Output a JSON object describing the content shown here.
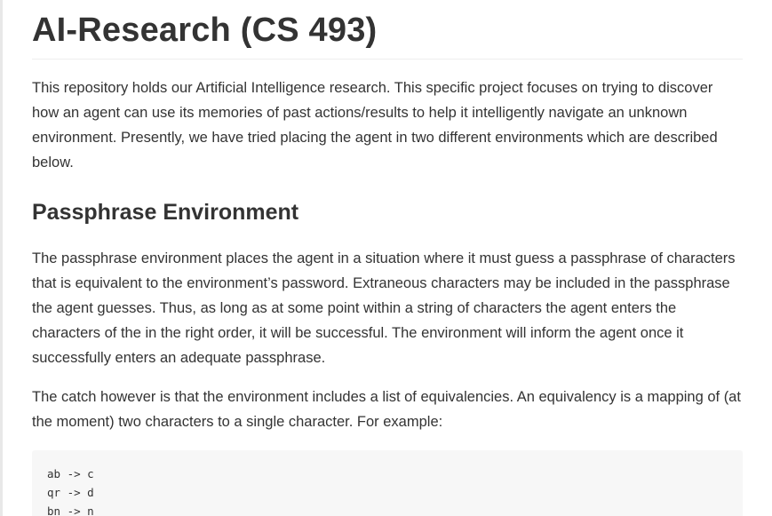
{
  "document": {
    "title": "AI-Research (CS 493)",
    "intro": "This repository holds our Artificial Intelligence research. This specific project focuses on trying to discover how an agent can use its memories of past actions/results to help it intelligently navigate an unknown environment. Presently, we have tried placing the agent in two different environments which are described below.",
    "sections": [
      {
        "heading": "Passphrase Environment",
        "paragraphs": [
          "The passphrase environment places the agent in a situation where it must guess a passphrase of characters that is equivalent to the environment’s password. Extraneous characters may be included in the passphrase the agent guesses. Thus, as long as at some point within a string of characters the agent enters the characters of the in the right order, it will be successful. The environment will inform the agent once it successfully enters an adequate passphrase.",
          "The catch however is that the environment includes a list of equivalencies. An equivalency is a mapping of (at the moment) two characters to a single character. For example:"
        ],
        "code_lines": [
          "ab -> c",
          "qr -> d",
          "bn -> n"
        ]
      }
    ]
  }
}
